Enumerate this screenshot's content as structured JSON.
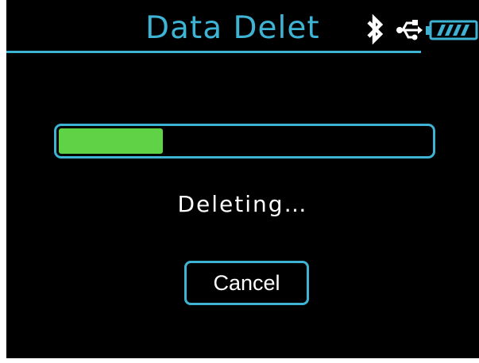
{
  "header": {
    "title": "Data Delet",
    "icons": [
      "bluetooth-icon",
      "usb-icon",
      "battery-icon"
    ]
  },
  "progress": {
    "fraction": 0.28
  },
  "status": {
    "text": "Deleting…"
  },
  "actions": {
    "cancel_label": "Cancel"
  },
  "colors": {
    "background": "#000000",
    "accent": "#3eb3d4",
    "progress_fill": "#5fd246",
    "text": "#ffffff"
  }
}
